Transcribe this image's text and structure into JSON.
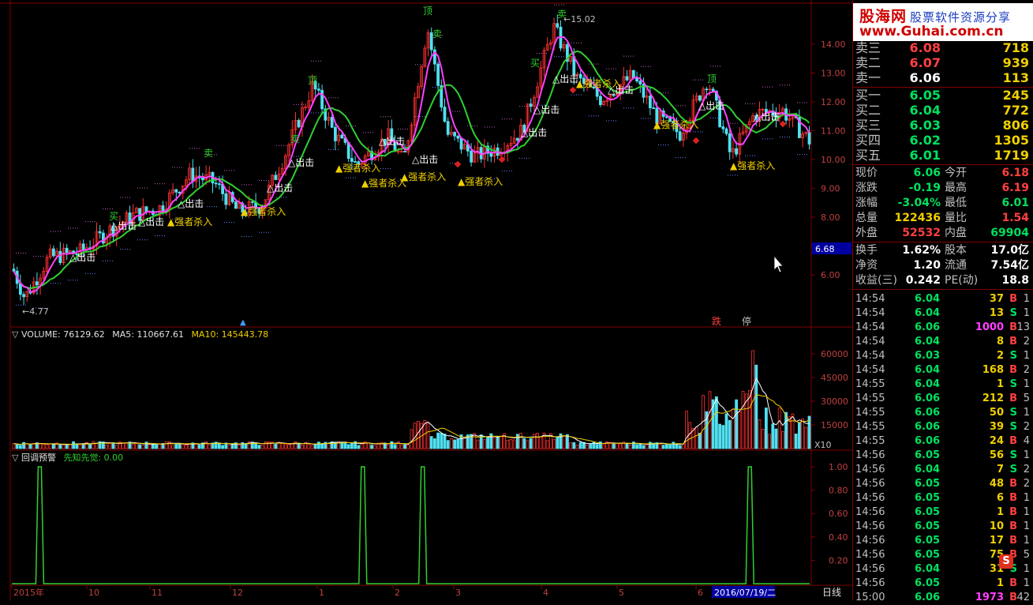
{
  "app": {
    "logo_title": "股海网",
    "logo_tagline": "股票软件资源分享",
    "logo_url_text": "www.Guhai.com.cn"
  },
  "colors": {
    "up": "#ff4040",
    "down": "#00e060",
    "ma_fast": "#ff40ff",
    "ma_slow": "#30d030",
    "bar_up": "#ff3030",
    "bar_down": "#50e0f0",
    "grid": "#800000"
  },
  "main_panel": {
    "price_axis_labels": [
      "14.00",
      "13.00",
      "12.00",
      "11.00",
      "10.00",
      "9.00",
      "8.00",
      "7.00",
      "6.00"
    ],
    "current_price_tag": "6.68",
    "high_marker": "15.02",
    "low_marker": "4.77",
    "signals": {
      "top": "顶",
      "sell": "卖",
      "buy": "买",
      "exit": "△出击",
      "strong_kill": "▲强者杀入"
    },
    "bottom_badges": [
      "跌",
      "停"
    ]
  },
  "volume_panel": {
    "header_name": "VOLUME: 76129.62",
    "header_ma5": "MA5: 110667.61",
    "header_ma10": "MA10: 145443.78",
    "axis_labels": [
      "60000",
      "45000",
      "30000",
      "15000"
    ],
    "unit_tag": "X10"
  },
  "indicator_panel": {
    "header_name": "回调预警",
    "header_value": "先知先觉: 0.00",
    "axis_labels": [
      "1.00",
      "0.80",
      "0.60",
      "0.40",
      "0.20"
    ],
    "spike_positions": [
      0.035,
      0.44,
      0.515,
      0.925
    ]
  },
  "time_axis": {
    "labels": [
      "2015年",
      "10",
      "11",
      "12",
      "1",
      "2",
      "3",
      "4",
      "5",
      "6"
    ],
    "cursor_date": "2016/07/19/二",
    "period": "日线"
  },
  "order_book": {
    "asks": [
      {
        "label": "卖三",
        "price": "6.08",
        "volume": "718"
      },
      {
        "label": "卖二",
        "price": "6.07",
        "volume": "939"
      },
      {
        "label": "卖一",
        "price": "6.06",
        "volume": "113"
      }
    ],
    "bids": [
      {
        "label": "买一",
        "price": "6.05",
        "volume": "245"
      },
      {
        "label": "买二",
        "price": "6.04",
        "volume": "772"
      },
      {
        "label": "买三",
        "price": "6.03",
        "volume": "806"
      },
      {
        "label": "买四",
        "price": "6.02",
        "volume": "1305"
      },
      {
        "label": "买五",
        "price": "6.01",
        "volume": "1719"
      }
    ]
  },
  "quote": [
    {
      "k1": "现价",
      "v1": "6.06",
      "c1": "dn",
      "k2": "今开",
      "v2": "6.18",
      "c2": "up"
    },
    {
      "k1": "涨跌",
      "v1": "-0.19",
      "c1": "dn",
      "k2": "最高",
      "v2": "6.19",
      "c2": "up"
    },
    {
      "k1": "涨幅",
      "v1": "-3.04%",
      "c1": "dn",
      "k2": "最低",
      "v2": "6.01",
      "c2": "dn"
    },
    {
      "k1": "总量",
      "v1": "122436",
      "c1": "yl",
      "k2": "量比",
      "v2": "1.54",
      "c2": "up"
    },
    {
      "k1": "外盘",
      "v1": "52532",
      "c1": "up",
      "k2": "内盘",
      "v2": "69904",
      "c2": "dn"
    }
  ],
  "fundamentals": [
    {
      "k1": "换手",
      "v1": "1.62%",
      "k2": "股本",
      "v2": "17.0亿"
    },
    {
      "k1": "净资",
      "v1": "1.20",
      "k2": "流通",
      "v2": "7.54亿"
    },
    {
      "k1": "收益(三)",
      "v1": "0.242",
      "k2": "PE(动)",
      "v2": "18.8"
    }
  ],
  "ticks": [
    {
      "t": "14:54",
      "p": "6.04",
      "v": "37",
      "s": "B",
      "n": "1"
    },
    {
      "t": "14:54",
      "p": "6.04",
      "v": "13",
      "s": "S",
      "n": "1"
    },
    {
      "t": "14:54",
      "p": "6.06",
      "v": "1000",
      "s": "B",
      "n": "13"
    },
    {
      "t": "14:54",
      "p": "6.04",
      "v": "8",
      "s": "B",
      "n": "2"
    },
    {
      "t": "14:54",
      "p": "6.03",
      "v": "2",
      "s": "S",
      "n": "1"
    },
    {
      "t": "14:54",
      "p": "6.04",
      "v": "168",
      "s": "B",
      "n": "2"
    },
    {
      "t": "14:55",
      "p": "6.04",
      "v": "1",
      "s": "S",
      "n": "1"
    },
    {
      "t": "14:55",
      "p": "6.06",
      "v": "212",
      "s": "B",
      "n": "5"
    },
    {
      "t": "14:55",
      "p": "6.06",
      "v": "50",
      "s": "S",
      "n": "1"
    },
    {
      "t": "14:55",
      "p": "6.06",
      "v": "39",
      "s": "S",
      "n": "2"
    },
    {
      "t": "14:55",
      "p": "6.06",
      "v": "24",
      "s": "B",
      "n": "4"
    },
    {
      "t": "14:56",
      "p": "6.05",
      "v": "56",
      "s": "S",
      "n": "1"
    },
    {
      "t": "14:56",
      "p": "6.04",
      "v": "7",
      "s": "S",
      "n": "2"
    },
    {
      "t": "14:56",
      "p": "6.05",
      "v": "48",
      "s": "B",
      "n": "2"
    },
    {
      "t": "14:56",
      "p": "6.05",
      "v": "6",
      "s": "B",
      "n": "1"
    },
    {
      "t": "14:56",
      "p": "6.05",
      "v": "1",
      "s": "B",
      "n": "1"
    },
    {
      "t": "14:56",
      "p": "6.05",
      "v": "10",
      "s": "B",
      "n": "1"
    },
    {
      "t": "14:56",
      "p": "6.05",
      "v": "17",
      "s": "B",
      "n": "1"
    },
    {
      "t": "14:56",
      "p": "6.05",
      "v": "75",
      "s": "B",
      "n": "5"
    },
    {
      "t": "14:56",
      "p": "6.04",
      "v": "31",
      "s": "S",
      "n": "1"
    },
    {
      "t": "14:56",
      "p": "6.05",
      "v": "1",
      "s": "B",
      "n": "1"
    },
    {
      "t": "15:00",
      "p": "6.06",
      "v": "1973",
      "s": "B",
      "n": "42"
    }
  ]
}
